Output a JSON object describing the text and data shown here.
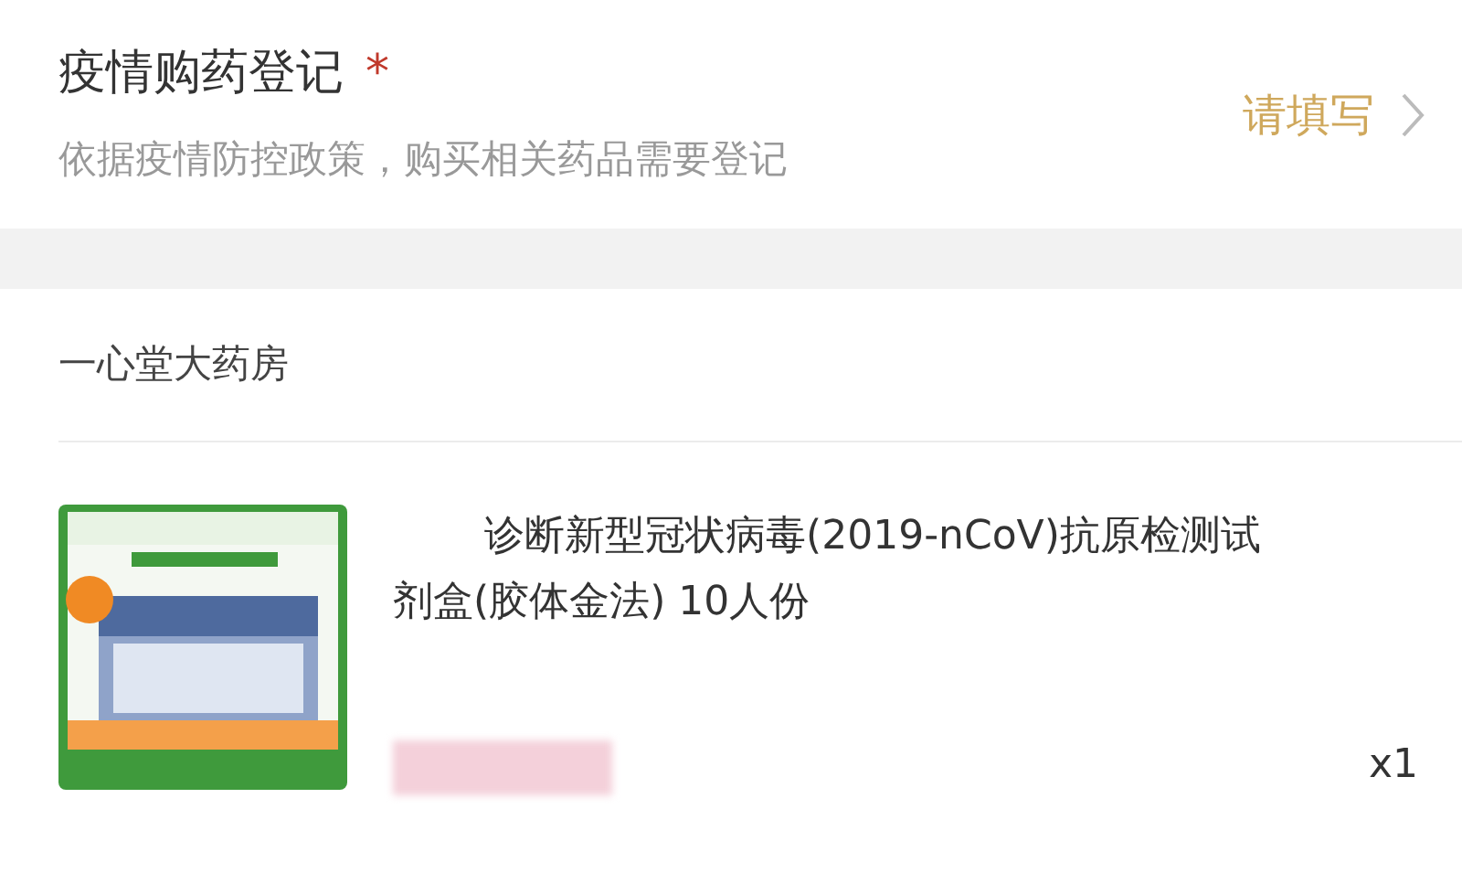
{
  "registration": {
    "title": "疫情购药登记",
    "required_mark": "*",
    "description": "依据疫情防控政策，购买相关药品需要登记",
    "action": "请填写"
  },
  "store": {
    "name": "一心堂大药房"
  },
  "items": [
    {
      "kind": "picture",
      "title": "诊断新型冠状病毒(2019-nCoV)抗原检测试剂盒(胶体金法) 10人份",
      "quantity": "x1"
    }
  ]
}
